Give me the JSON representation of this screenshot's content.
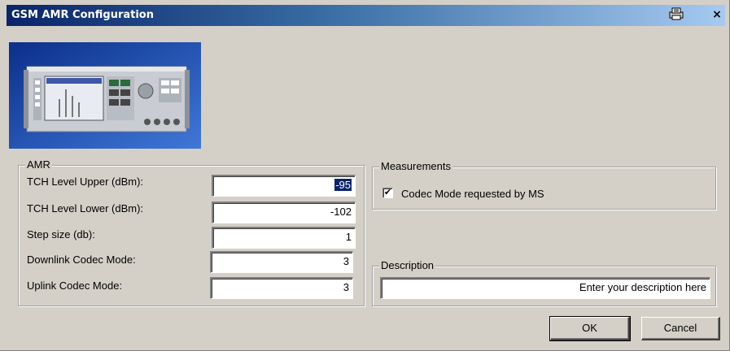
{
  "window": {
    "title": "GSM AMR Configuration",
    "print_icon": "printer-icon",
    "close_glyph": "×"
  },
  "amr": {
    "legend": "AMR",
    "tch_upper": {
      "label": "TCH Level Upper (dBm):",
      "value": "-95"
    },
    "tch_lower": {
      "label": "TCH Level Lower (dBm):",
      "value": "-102"
    },
    "step_size": {
      "label": "Step size (db):",
      "value": "1"
    },
    "downlink": {
      "label": "Downlink Codec Mode:",
      "value": "3"
    },
    "uplink": {
      "label": "Uplink Codec Mode:",
      "value": "3"
    }
  },
  "measurements": {
    "legend": "Measurements",
    "codec_mode_label": "Codec Mode requested by MS",
    "codec_mode_checked": true,
    "check_glyph": "✔"
  },
  "description": {
    "legend": "Description",
    "value": "Enter your description here"
  },
  "buttons": {
    "ok": "OK",
    "cancel": "Cancel"
  },
  "colors": {
    "title_start": "#0a246a",
    "title_end": "#a6caf0",
    "face": "#d4d0c8",
    "selection": "#0a246a"
  }
}
